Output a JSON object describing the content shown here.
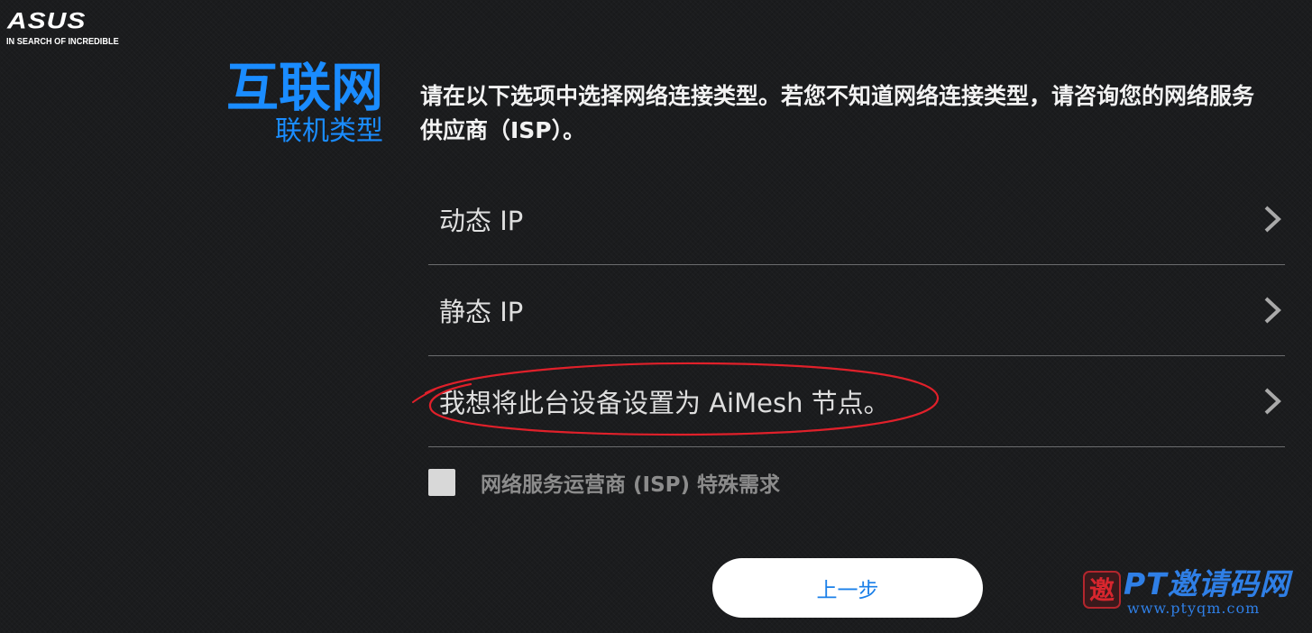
{
  "brand": {
    "name": "ASUS",
    "tagline": "IN SEARCH OF INCREDIBLE"
  },
  "heading": {
    "title": "互联网",
    "subtitle": "联机类型"
  },
  "description": "请在以下选项中选择网络连接类型。若您不知道网络连接类型，请咨询您的网络服务供应商（ISP）。",
  "options": [
    {
      "label": "动态 IP"
    },
    {
      "label": "静态 IP"
    },
    {
      "label": "我想将此台设备设置为 AiMesh 节点。"
    }
  ],
  "isp_special": {
    "label": "网络服务运营商 (ISP) 特殊需求",
    "checked": false
  },
  "back_button": {
    "label": "上一步"
  },
  "watermark": {
    "seal": "邀",
    "text": "PT邀请码网",
    "url": "www.ptyqm.com"
  },
  "colors": {
    "accent": "#1a8cff",
    "annotation": "#e0202a",
    "background": "#1c1d1f"
  },
  "icons": {
    "option_arrow": "chevron-right-icon",
    "annotation": "red-ellipse-annotation"
  }
}
